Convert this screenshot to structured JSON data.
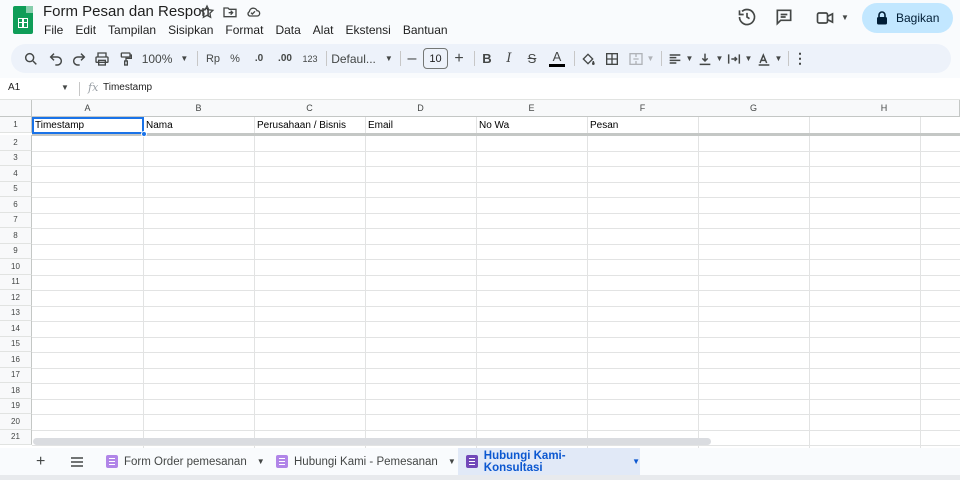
{
  "app": {
    "title": "Form Pesan dan Respon",
    "menu": [
      "File",
      "Edit",
      "Tampilan",
      "Sisipkan",
      "Format",
      "Data",
      "Alat",
      "Ekstensi",
      "Bantuan"
    ],
    "share_label": "Bagikan"
  },
  "toolbar": {
    "zoom": "100%",
    "currency": "Rp",
    "percent": "%",
    "decrease_decimal": ".0",
    "increase_decimal": ".00",
    "number_format": "123",
    "font_family": "Defaul...",
    "font_size": "10",
    "accent_text_color": "#000000"
  },
  "formula_bar": {
    "cell_ref": "A1",
    "fx": "fx",
    "value": "Timestamp"
  },
  "grid": {
    "columns": [
      "A",
      "B",
      "C",
      "D",
      "E",
      "F",
      "G",
      "H"
    ],
    "rows": [
      "1",
      "2",
      "3",
      "4",
      "5",
      "6",
      "7",
      "8",
      "9",
      "10",
      "11",
      "12",
      "13",
      "14",
      "15",
      "16",
      "17",
      "18",
      "19",
      "20",
      "21"
    ],
    "row1": [
      "Timestamp",
      "Nama",
      "Perusahaan / Bisnis",
      "Email",
      "No Wa",
      "Pesan",
      "",
      ""
    ]
  },
  "sheet_tabs": {
    "add": "+",
    "tabs": [
      {
        "label": "Form Order pemesanan",
        "active": false
      },
      {
        "label": "Hubungi Kami - Pemesanan",
        "active": false
      },
      {
        "label": "Hubungi Kami-Konsultasi",
        "active": true
      }
    ]
  },
  "colors": {
    "share_bg": "#c2e7ff",
    "selection": "#1a73e8",
    "sheets_green": "#0f9d58",
    "active_tab": "#0b57d0"
  }
}
